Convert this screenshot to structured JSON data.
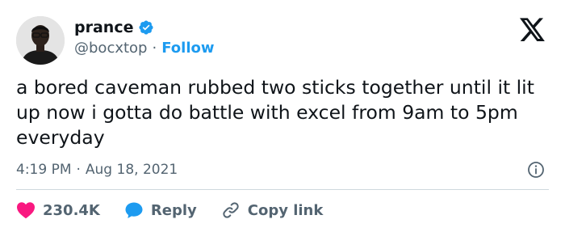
{
  "author": {
    "display_name": "prance",
    "handle": "@bocxtop",
    "separator": "·",
    "follow_label": "Follow",
    "verified_icon": "verified-badge-icon",
    "avatar": "profile-photo"
  },
  "brand_icon": "x-logo-icon",
  "tweet": {
    "text": "a bored caveman rubbed two sticks together until it lit up now i gotta do battle with excel from 9am to 5pm everyday",
    "time": "4:19 PM",
    "separator": "·",
    "date": "Aug 18, 2021"
  },
  "actions": {
    "likes": "230.4K",
    "reply_label": "Reply",
    "copy_link_label": "Copy link"
  },
  "colors": {
    "accent": "#1d9bf0",
    "like": "#f91880",
    "text": "#0f1419",
    "muted": "#536471"
  }
}
